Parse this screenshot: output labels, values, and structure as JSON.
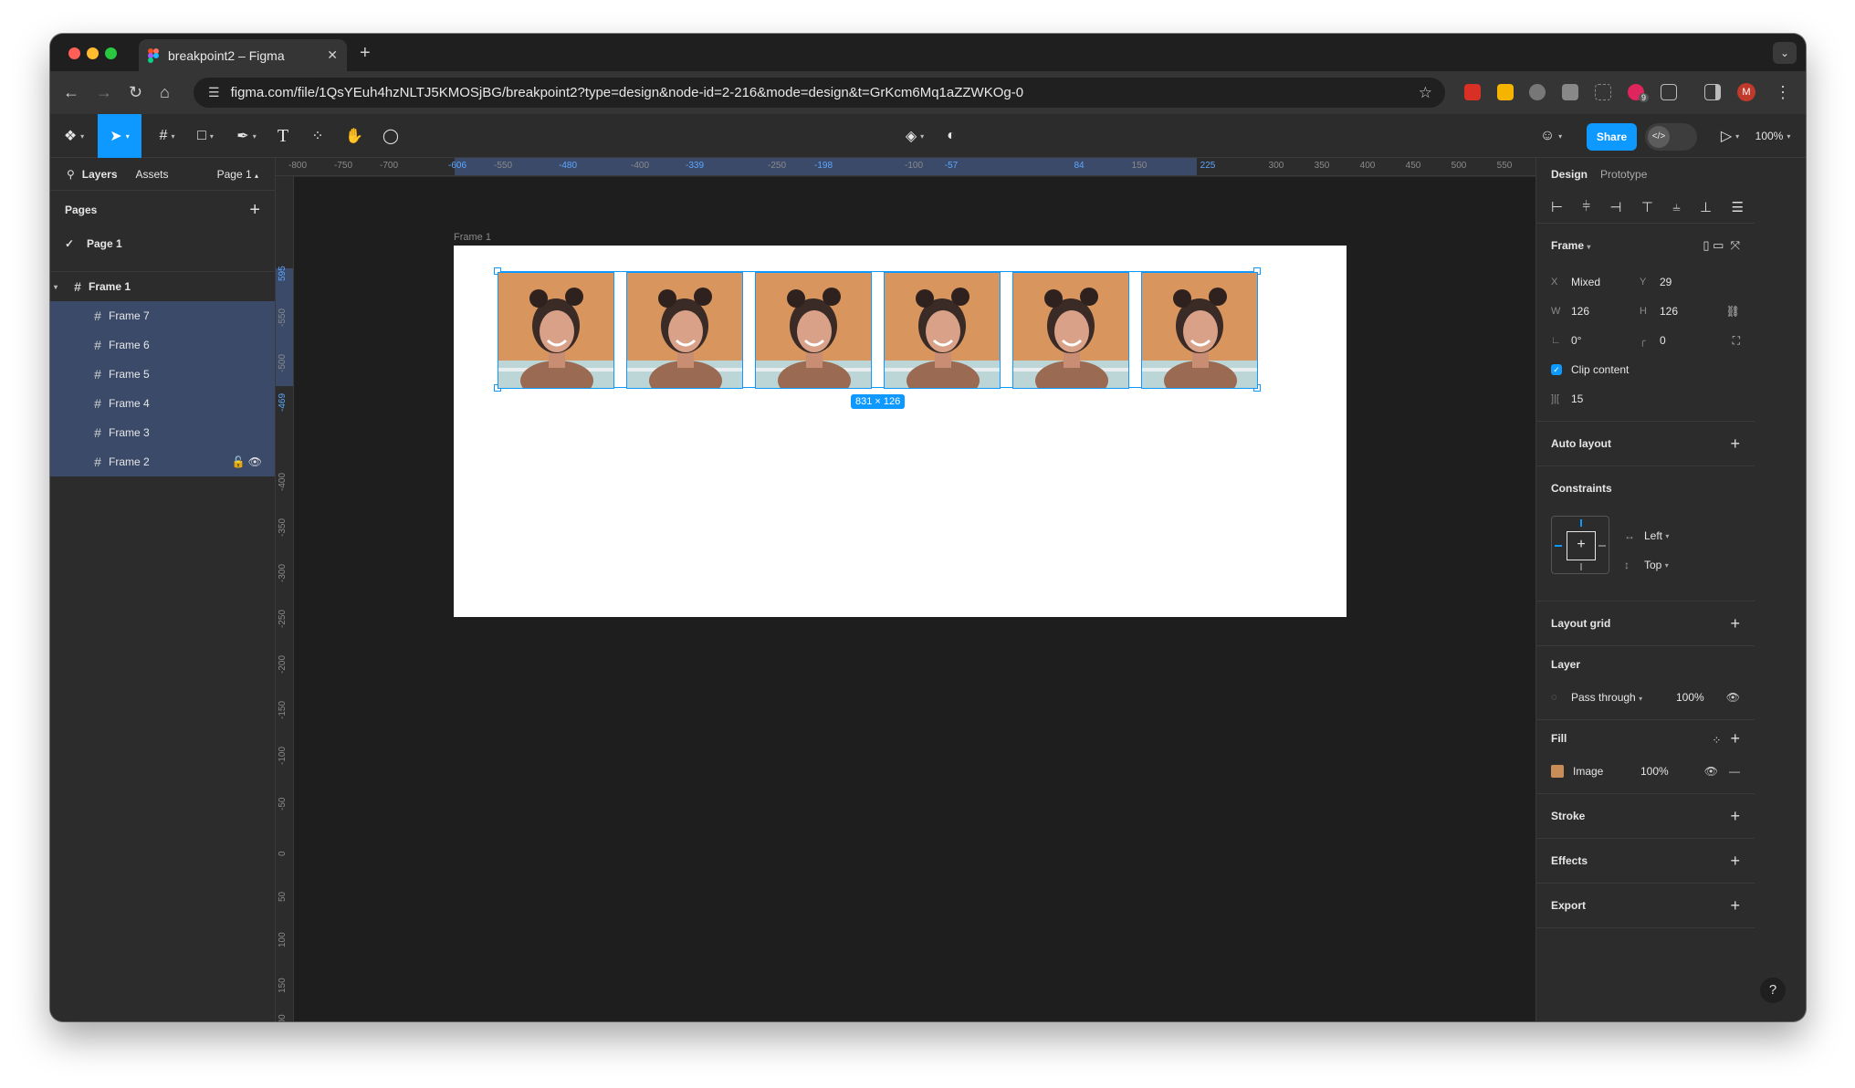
{
  "browser": {
    "tab_title": "breakpoint2 – Figma",
    "url": "figma.com/file/1QsYEuh4hzNLTJ5KMOSjBG/breakpoint2?type=design&node-id=2-216&mode=design&t=GrKcm6Mq1aZZWKOg-0",
    "profile_initial": "M",
    "extension_badge": "9"
  },
  "toolbar": {
    "share_label": "Share",
    "zoom": "100%"
  },
  "left_panel": {
    "tab_layers": "Layers",
    "tab_assets": "Assets",
    "page_selector": "Page 1",
    "pages_header": "Pages",
    "pages": [
      "Page 1"
    ],
    "layers_parent": "Frame 1",
    "layers": [
      "Frame 7",
      "Frame 6",
      "Frame 5",
      "Frame 4",
      "Frame 3",
      "Frame 2"
    ]
  },
  "ruler": {
    "top": [
      "-800",
      "-750",
      "-700",
      "-606",
      "-550",
      "-480",
      "-400",
      "-339",
      "-250",
      "-198",
      "-100",
      "-57",
      "84",
      "150",
      "225",
      "300",
      "350",
      "400",
      "450",
      "500",
      "550"
    ],
    "left": [
      "595",
      "-550",
      "-500",
      "-469",
      "-400",
      "-350",
      "-300",
      "-250",
      "-200",
      "-150",
      "-100",
      "-50",
      "0",
      "50",
      "100",
      "150",
      "200"
    ]
  },
  "canvas": {
    "frame_label": "Frame 1",
    "selection_size": "831 × 126",
    "photo_count": 6
  },
  "right_panel": {
    "tab_design": "Design",
    "tab_prototype": "Prototype",
    "frame_label": "Frame",
    "x_label": "X",
    "x_value": "Mixed",
    "y_label": "Y",
    "y_value": "29",
    "w_label": "W",
    "w_value": "126",
    "h_label": "H",
    "h_value": "126",
    "rotation": "0°",
    "radius": "0",
    "clip_content": "Clip content",
    "spacing": "15",
    "auto_layout": "Auto layout",
    "constraints": "Constraints",
    "constraint_h": "Left",
    "constraint_v": "Top",
    "layout_grid": "Layout grid",
    "layer": "Layer",
    "blend_mode": "Pass through",
    "layer_opacity": "100%",
    "fill": "Fill",
    "fill_type": "Image",
    "fill_opacity": "100%",
    "stroke": "Stroke",
    "effects": "Effects",
    "export": "Export"
  },
  "colors": {
    "accent": "#0d99ff",
    "selection_row": "#3c4a6a",
    "canvas_bg": "#1e1e1e",
    "panel_bg": "#2c2c2c"
  },
  "icons": {
    "help": "?"
  }
}
